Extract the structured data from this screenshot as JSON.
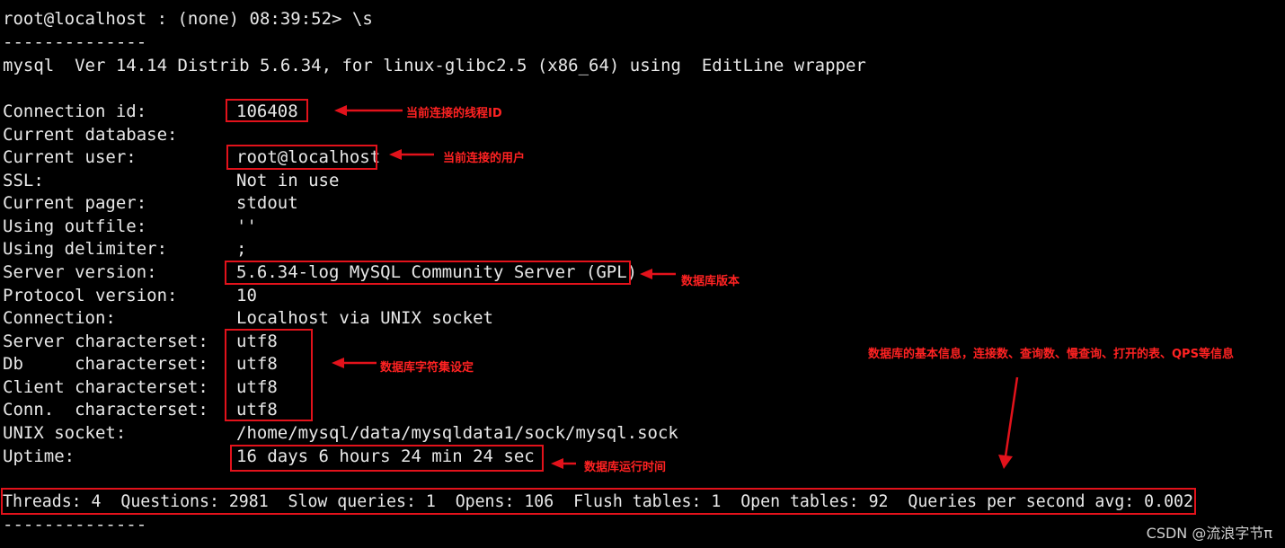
{
  "terminal": {
    "prompt": "root@localhost : (none) 08:39:52> \\s",
    "separator": "--------------",
    "version_line": "mysql  Ver 14.14 Distrib 5.6.34, for linux-glibc2.5 (x86_64) using  EditLine wrapper",
    "rows": [
      {
        "label": "Connection id:",
        "value": "106408"
      },
      {
        "label": "Current database:",
        "value": ""
      },
      {
        "label": "Current user:",
        "value": "root@localhost"
      },
      {
        "label": "SSL:",
        "value": "Not in use"
      },
      {
        "label": "Current pager:",
        "value": "stdout"
      },
      {
        "label": "Using outfile:",
        "value": "''"
      },
      {
        "label": "Using delimiter:",
        "value": ";"
      },
      {
        "label": "Server version:",
        "value": "5.6.34-log MySQL Community Server (GPL)"
      },
      {
        "label": "Protocol version:",
        "value": "10"
      },
      {
        "label": "Connection:",
        "value": "Localhost via UNIX socket"
      },
      {
        "label": "Server characterset:",
        "value": "utf8"
      },
      {
        "label": "Db     characterset:",
        "value": "utf8"
      },
      {
        "label": "Client characterset:",
        "value": "utf8"
      },
      {
        "label": "Conn.  characterset:",
        "value": "utf8"
      },
      {
        "label": "UNIX socket:",
        "value": "/home/mysql/data/mysqldata1/sock/mysql.sock"
      },
      {
        "label": "Uptime:",
        "value": "16 days 6 hours 24 min 24 sec"
      }
    ],
    "stats_line": "Threads: 4  Questions: 2981  Slow queries: 1  Opens: 106  Flush tables: 1  Open tables: 92  Queries per second avg: 0.002",
    "separator_end": "--------------"
  },
  "annotations": {
    "connection_id": "当前连接的线程ID",
    "current_user": "当前连接的用户",
    "server_version": "数据库版本",
    "charset": "数据库字符集设定",
    "stats": "数据库的基本信息，连接数、查询数、慢查询、打开的表、QPS等信息",
    "uptime": "数据库运行时间"
  },
  "colors": {
    "annotation": "#e2121b",
    "background": "#000000",
    "text": "#e8e8e8"
  },
  "watermark": "CSDN @流浪字节π"
}
